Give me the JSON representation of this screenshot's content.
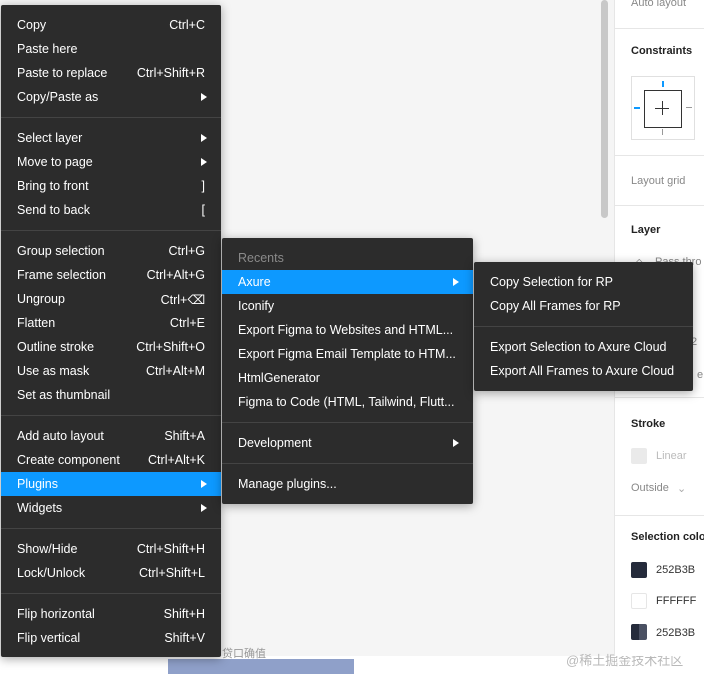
{
  "context_menu": {
    "items": [
      {
        "label": "Copy",
        "shortcut": "Ctrl+C"
      },
      {
        "label": "Paste here",
        "shortcut": ""
      },
      {
        "label": "Paste to replace",
        "shortcut": "Ctrl+Shift+R"
      },
      {
        "label": "Copy/Paste as",
        "shortcut": ""
      },
      {
        "label": "Select layer",
        "shortcut": ""
      },
      {
        "label": "Move to page",
        "shortcut": ""
      },
      {
        "label": "Bring to front",
        "shortcut": "]"
      },
      {
        "label": "Send to back",
        "shortcut": "["
      },
      {
        "label": "Group selection",
        "shortcut": "Ctrl+G"
      },
      {
        "label": "Frame selection",
        "shortcut": "Ctrl+Alt+G"
      },
      {
        "label": "Ungroup",
        "shortcut": "Ctrl+⌫"
      },
      {
        "label": "Flatten",
        "shortcut": "Ctrl+E"
      },
      {
        "label": "Outline stroke",
        "shortcut": "Ctrl+Shift+O"
      },
      {
        "label": "Use as mask",
        "shortcut": "Ctrl+Alt+M"
      },
      {
        "label": "Set as thumbnail",
        "shortcut": ""
      },
      {
        "label": "Add auto layout",
        "shortcut": "Shift+A"
      },
      {
        "label": "Create component",
        "shortcut": "Ctrl+Alt+K"
      },
      {
        "label": "Plugins",
        "shortcut": ""
      },
      {
        "label": "Widgets",
        "shortcut": ""
      },
      {
        "label": "Show/Hide",
        "shortcut": "Ctrl+Shift+H"
      },
      {
        "label": "Lock/Unlock",
        "shortcut": "Ctrl+Shift+L"
      },
      {
        "label": "Flip horizontal",
        "shortcut": "Shift+H"
      },
      {
        "label": "Flip vertical",
        "shortcut": "Shift+V"
      }
    ]
  },
  "plugins_menu": {
    "section_header": "Recents",
    "items": [
      {
        "label": "Axure"
      },
      {
        "label": "Iconify"
      },
      {
        "label": "Export Figma to Websites and HTML..."
      },
      {
        "label": "Export Figma Email Template to HTM..."
      },
      {
        "label": "HtmlGenerator"
      },
      {
        "label": "Figma to Code (HTML, Tailwind, Flutt..."
      },
      {
        "label": "Development"
      },
      {
        "label": "Manage plugins..."
      }
    ]
  },
  "axure_menu": {
    "items": [
      {
        "label": "Copy Selection for RP"
      },
      {
        "label": "Copy All Frames for RP"
      },
      {
        "label": "Export Selection to Axure Cloud"
      },
      {
        "label": "Export All Frames to Axure Cloud"
      }
    ]
  },
  "panel": {
    "auto_layout": "Auto layout",
    "constraints": "Constraints",
    "layout_grid": "Layout grid",
    "layer": "Layer",
    "layer_mode": "Pass thro",
    "partial_2": "2",
    "partial_e": "e",
    "stroke": "Stroke",
    "stroke_type": "Linear",
    "stroke_position": "Outside",
    "selection_colors": "Selection colo",
    "colors": [
      {
        "hex": "252B3B",
        "value": "#252b3b"
      },
      {
        "hex": "FFFFFF",
        "value": "#ffffff"
      },
      {
        "hex": "252B3B",
        "value": "#252b3b"
      }
    ]
  },
  "canvas": {
    "bottom_text": "贷口确值",
    "watermark": "@稀土掘金技术社区"
  },
  "colors": {
    "menu_bg": "#2c2c2c",
    "accent": "#0d99ff"
  }
}
